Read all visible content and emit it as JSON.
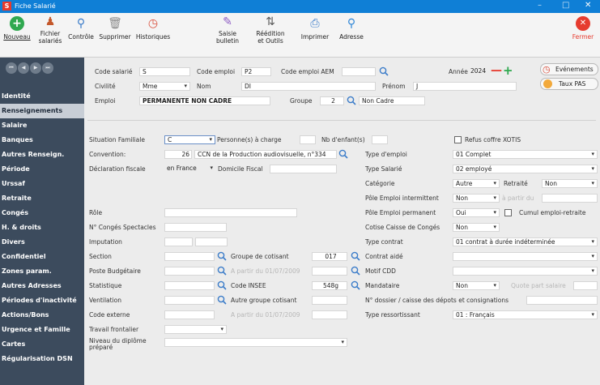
{
  "window": {
    "title": "Fiche Salarié",
    "app_icon": "S"
  },
  "toolbar": {
    "nouveau": "Nouveau",
    "fichier_salaries_1": "Fichier",
    "fichier_salaries_2": "salariés",
    "controle": "Contrôle",
    "supprimer": "Supprimer",
    "historiques": "Historiques",
    "saisie_1": "Saisie",
    "saisie_2": "bulletin",
    "reedition_1": "Réédition",
    "reedition_2": "et Outils",
    "imprimer": "Imprimer",
    "adresse": "Adresse",
    "fermer": "Fermer"
  },
  "sidebar": {
    "items": [
      "Identité",
      "Renseignements",
      "Salaire",
      "Banques",
      "Autres Renseign.",
      "Période",
      "Urssaf",
      "Retraite",
      "Congés",
      "H. & droits",
      "Divers",
      "Confidentiel",
      "Zones param.",
      "Autres Adresses",
      "Périodes d'inactivité",
      "Actions/Bons",
      "Urgence et Famille",
      "Cartes",
      "Régularisation DSN"
    ],
    "active_index": 1
  },
  "header": {
    "code_salarie_label": "Code salarié",
    "code_salarie": "S",
    "code_emploi_label": "Code emploi",
    "code_emploi": "P2",
    "code_emploi_aem_label": "Code emploi AEM",
    "annee_label": "Année",
    "annee": "2024",
    "civilite_label": "Civilité",
    "civilite": "Mme",
    "nom_label": "Nom",
    "nom": "DI",
    "prenom_label": "Prénom",
    "prenom": "J",
    "emploi_label": "Emploi",
    "emploi": "PERMANENTE NON CADRE",
    "groupe_label": "Groupe",
    "groupe": "2",
    "groupe_desc": "Non Cadre",
    "evenements": "Evénements",
    "taux_pas": "Taux PAS"
  },
  "form": {
    "situation_familiale": "Situation Familiale",
    "situation_value": "C",
    "personnes_charge": "Personne(s) à charge",
    "nb_enfants": "Nb d'enfant(s)",
    "refus_coffre": "Refus coffre XOTIS",
    "convention_label": "Convention:",
    "convention_num": "26",
    "convention_text": "CCN de la Production audiovisuelle, n°334",
    "type_emploi_label": "Type d'emploi",
    "type_emploi": "01 Complet",
    "declaration_fiscale": "Déclaration fiscale",
    "declaration_value": "en France",
    "domicile_fiscal": "Domicile Fiscal",
    "type_salarie_label": "Type Salarié",
    "type_salarie": "02 employé",
    "categorie_label": "Catégorie",
    "categorie": "Autre",
    "retraite_label": "Retraité",
    "retraite": "Non",
    "pole_intermittent_label": "Pôle Emploi intermittent",
    "pole_intermittent": "Non",
    "a_partir_du": "à partir du",
    "role_label": "Rôle",
    "pole_permanent_label": "Pôle Emploi permanent",
    "pole_permanent": "Oui",
    "cumul": "Cumul emploi-retraite",
    "conges_spectacles_label": "N° Congés Spectacles",
    "cotise_caisse_label": "Cotise Caisse de Congés",
    "cotise_caisse": "Non",
    "imputation_label": "Imputation",
    "type_contrat_label": "Type contrat",
    "type_contrat": "01 contrat à durée indéterminée",
    "section_label": "Section",
    "groupe_cotisant": "Groupe de cotisant",
    "groupe_cotisant_value": "017",
    "contrat_aide": "Contrat aidé",
    "poste_budgetaire": "Poste Budgétaire",
    "a_partir_2009": "A partir du 01/07/2009",
    "motif_cdd": "Motif CDD",
    "statistique": "Statistique",
    "code_insee": "Code INSEE",
    "code_insee_value": "548g",
    "mandataire": "Mandataire",
    "mandataire_value": "Non",
    "quote_part": "Quote part salaire",
    "ventilation": "Ventilation",
    "autre_groupe": "Autre groupe cotisant",
    "dossier_caisse": "N° dossier / caisse des dépots et consignations",
    "code_externe": "Code externe",
    "a_partir_2009b": "A partir du 01/07/2009",
    "type_ressortissant_label": "Type ressortissant",
    "type_ressortissant": "01 : Français",
    "travail_frontalier": "Travail frontalier",
    "niveau_diplome_1": "Niveau du diplôme",
    "niveau_diplome_2": "préparé"
  },
  "colors": {
    "titlebar": "#0f7fd6",
    "sidebar": "#3c4b5d",
    "accent_red": "#e63b2e",
    "accent_green": "#2fa84f"
  }
}
